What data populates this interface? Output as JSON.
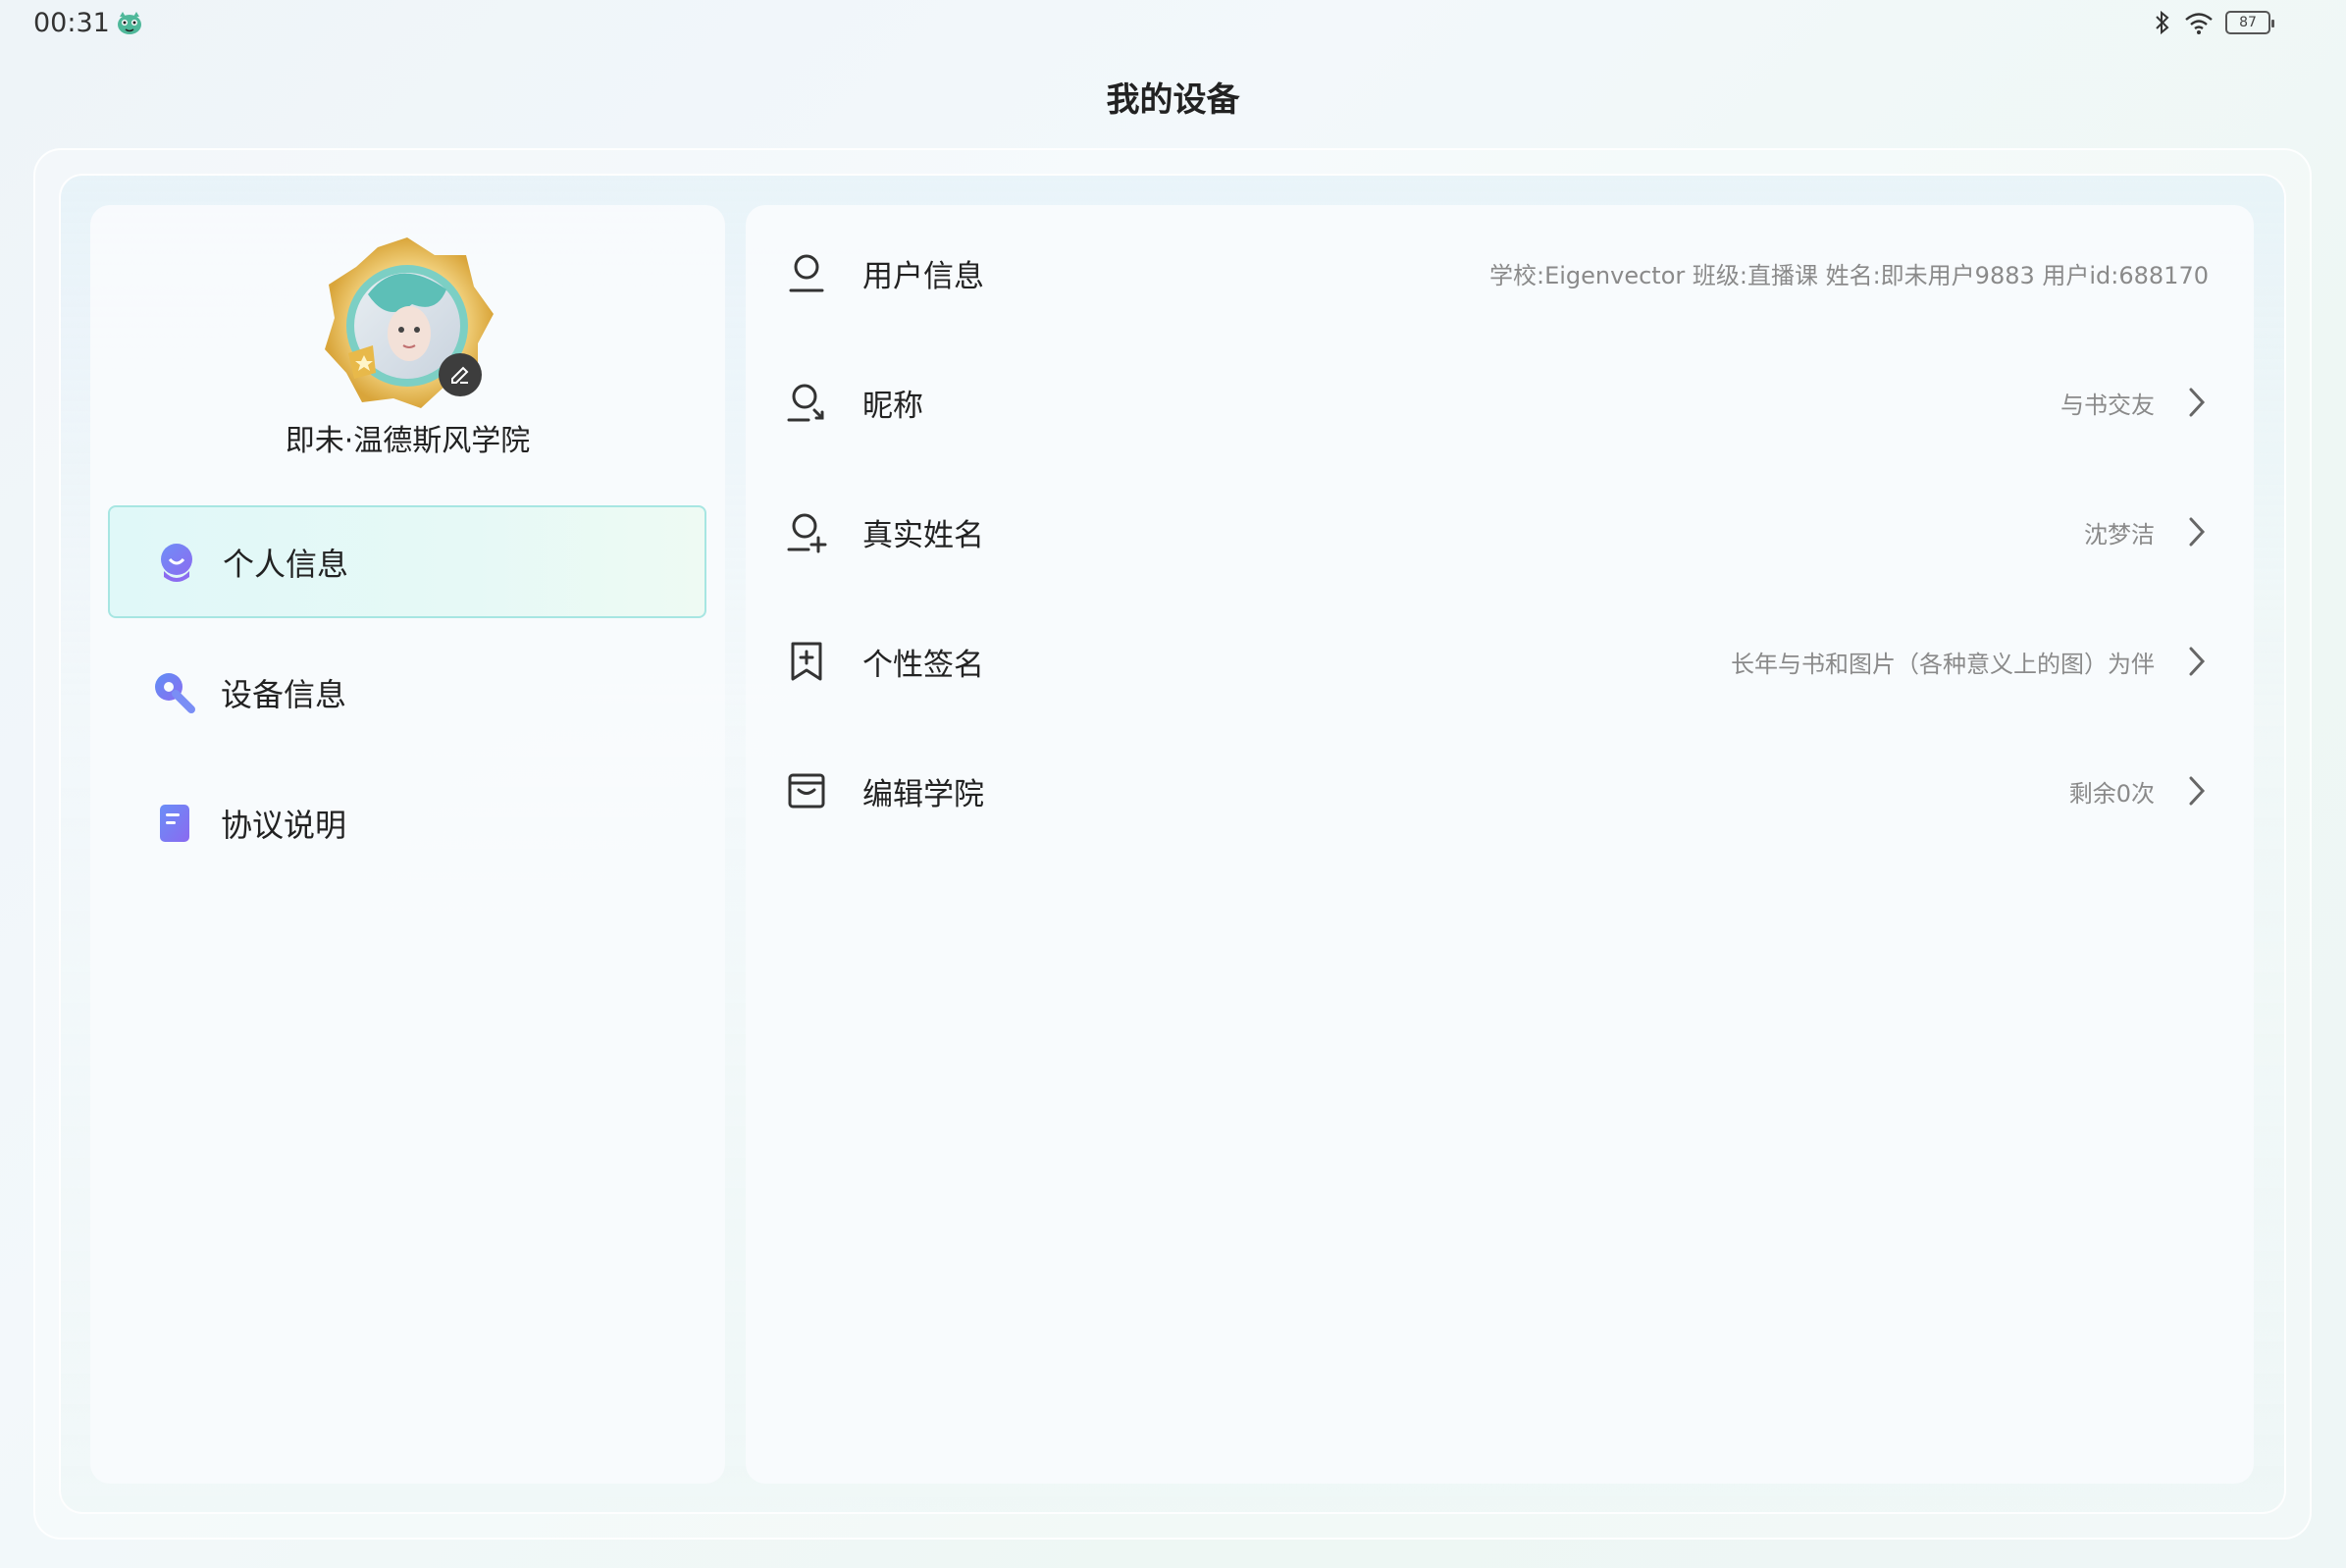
{
  "status_bar": {
    "time": "00:31",
    "battery_level": "87",
    "icons": [
      "app-mascot-icon",
      "bluetooth-icon",
      "wifi-icon",
      "battery-icon"
    ]
  },
  "page": {
    "title": "我的设备"
  },
  "profile": {
    "name": "即未·温德斯风学院"
  },
  "sidebar": {
    "items": [
      {
        "label": "个人信息",
        "icon": "person-chat-icon",
        "active": true
      },
      {
        "label": "设备信息",
        "icon": "wrench-icon",
        "active": false
      },
      {
        "label": "协议说明",
        "icon": "document-icon",
        "active": false
      }
    ]
  },
  "details": {
    "rows": [
      {
        "label": "用户信息",
        "icon": "user-icon",
        "value": "学校:Eigenvector   班级:直播课   姓名:即未用户9883   用户id:688170",
        "chevron": false
      },
      {
        "label": "昵称",
        "icon": "user-edit-icon",
        "value": "与书交友",
        "chevron": true
      },
      {
        "label": "真实姓名",
        "icon": "user-add-icon",
        "value": "沈梦洁",
        "chevron": true
      },
      {
        "label": "个性签名",
        "icon": "bookmark-plus-icon",
        "value": "长年与书和图片（各种意义上的图）为伴",
        "chevron": true
      },
      {
        "label": "编辑学院",
        "icon": "college-icon",
        "value": "剩余0次",
        "chevron": true
      }
    ]
  },
  "colors": {
    "accent_teal": "#a7e6e2",
    "active_bg": "#e0f8f8",
    "icon_purple": "#7b6ff0",
    "icon_blue": "#5f8ff5"
  }
}
